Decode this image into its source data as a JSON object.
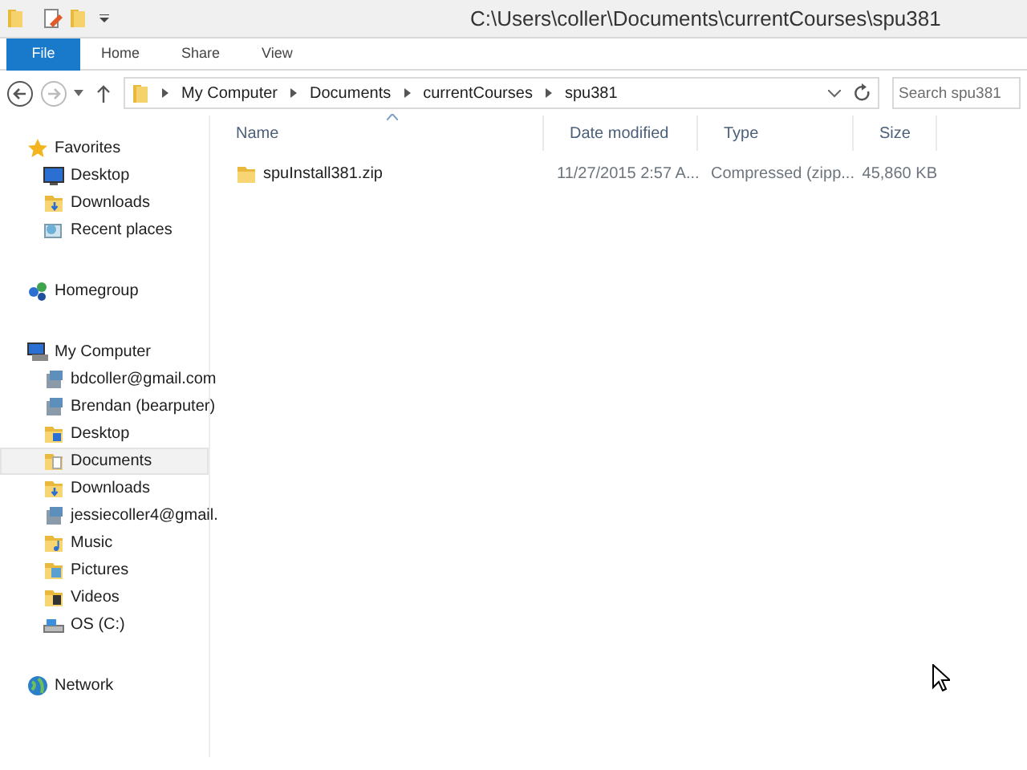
{
  "window": {
    "title": "C:\\Users\\coller\\Documents\\currentCourses\\spu381"
  },
  "ribbon_tabs": [
    {
      "label": "File",
      "selected": true
    },
    {
      "label": "Home",
      "selected": false
    },
    {
      "label": "Share",
      "selected": false
    },
    {
      "label": "View",
      "selected": false
    }
  ],
  "address": {
    "crumbs": [
      "My Computer",
      "Documents",
      "currentCourses",
      "spu381"
    ]
  },
  "search": {
    "placeholder": "Search spu381"
  },
  "sidebar": {
    "groups": [
      {
        "label": "Favorites",
        "children": [
          {
            "label": "Desktop",
            "selected": false
          },
          {
            "label": "Downloads",
            "selected": false
          },
          {
            "label": "Recent places",
            "selected": false
          }
        ]
      },
      {
        "label": "Homegroup"
      },
      {
        "label": "My Computer",
        "children": [
          {
            "label": "bdcoller@gmail.com",
            "selected": false
          },
          {
            "label": "Brendan (bearputer)",
            "selected": false
          },
          {
            "label": "Desktop",
            "selected": false
          },
          {
            "label": "Documents",
            "selected": true
          },
          {
            "label": "Downloads",
            "selected": false
          },
          {
            "label": "jessiecoller4@gmail.",
            "selected": false
          },
          {
            "label": "Music",
            "selected": false
          },
          {
            "label": "Pictures",
            "selected": false
          },
          {
            "label": "Videos",
            "selected": false
          },
          {
            "label": "OS (C:)",
            "selected": false
          }
        ]
      },
      {
        "label": "Network"
      }
    ]
  },
  "table": {
    "columns": [
      "Name",
      "Date modified",
      "Type",
      "Size"
    ],
    "rows": [
      {
        "name": "spuInstall381.zip",
        "date": "11/27/2015 2:57 A...",
        "type": "Compressed (zipp...",
        "size": "45,860 KB"
      }
    ]
  }
}
